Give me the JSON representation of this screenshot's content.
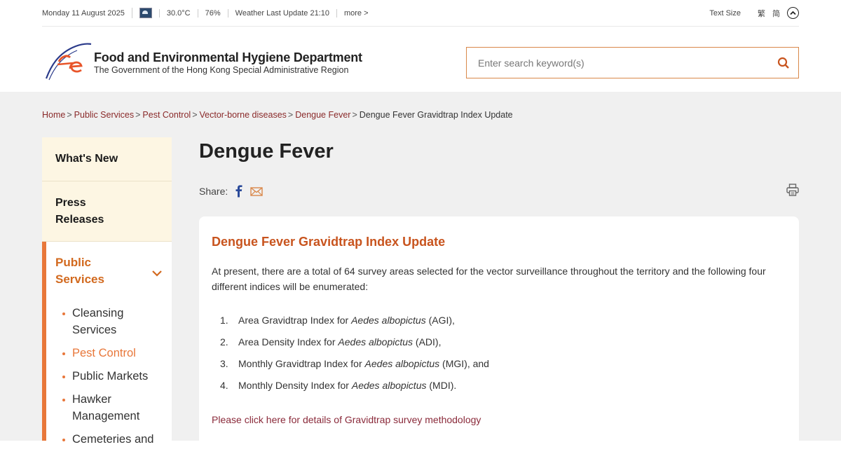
{
  "topbar": {
    "date": "Monday 11 August 2025",
    "temperature": "30.0°C",
    "humidity": "76%",
    "weather_update": "Weather Last Update 21:10",
    "more": "more >",
    "text_size": "Text Size",
    "lang_tc": "繁",
    "lang_sc": "简"
  },
  "header": {
    "dept_name": "Food and Environmental Hygiene Department",
    "dept_sub": "The Government of the Hong Kong Special Administrative Region",
    "search_placeholder": "Enter search keyword(s)"
  },
  "breadcrumb": {
    "items": [
      "Home",
      "Public Services",
      "Pest Control",
      "Vector-borne diseases",
      "Dengue Fever"
    ],
    "current": "Dengue Fever Gravidtrap Index Update"
  },
  "sidebar": {
    "whats_new": "What's New",
    "press_line1": "Press",
    "press_line2": "Releases",
    "public_line1": "Public",
    "public_line2": "Services",
    "sub_items": [
      "Cleansing Services",
      "Pest Control",
      "Public Markets",
      "Hawker Management",
      "Cemeteries and"
    ]
  },
  "page": {
    "title": "Dengue Fever",
    "share_label": "Share:"
  },
  "content": {
    "title": "Dengue Fever Gravidtrap Index Update",
    "intro": "At present, there are a total of 64 survey areas selected for the vector surveillance throughout the territory and the following four different indices will be enumerated:",
    "indices": [
      {
        "num": "1.",
        "pre": "Area Gravidtrap Index for ",
        "species": "Aedes albopictus",
        "post": " (AGI),"
      },
      {
        "num": "2.",
        "pre": "Area Density Index for ",
        "species": "Aedes albopictus",
        "post": " (ADI),"
      },
      {
        "num": "3.",
        "pre": "Monthly Gravidtrap Index for ",
        "species": "Aedes albopictus",
        "post": " (MGI), and"
      },
      {
        "num": "4.",
        "pre": "Monthly Density Index for ",
        "species": "Aedes albopictus",
        "post": " (MDI)."
      }
    ],
    "link": "Please click here for details of Gravidtrap survey methodology"
  },
  "colors": {
    "accent": "#e8773a",
    "title_orange": "#c8541e",
    "link_red": "#8a2a2a",
    "sidebar_cream": "#fdf6e3"
  }
}
